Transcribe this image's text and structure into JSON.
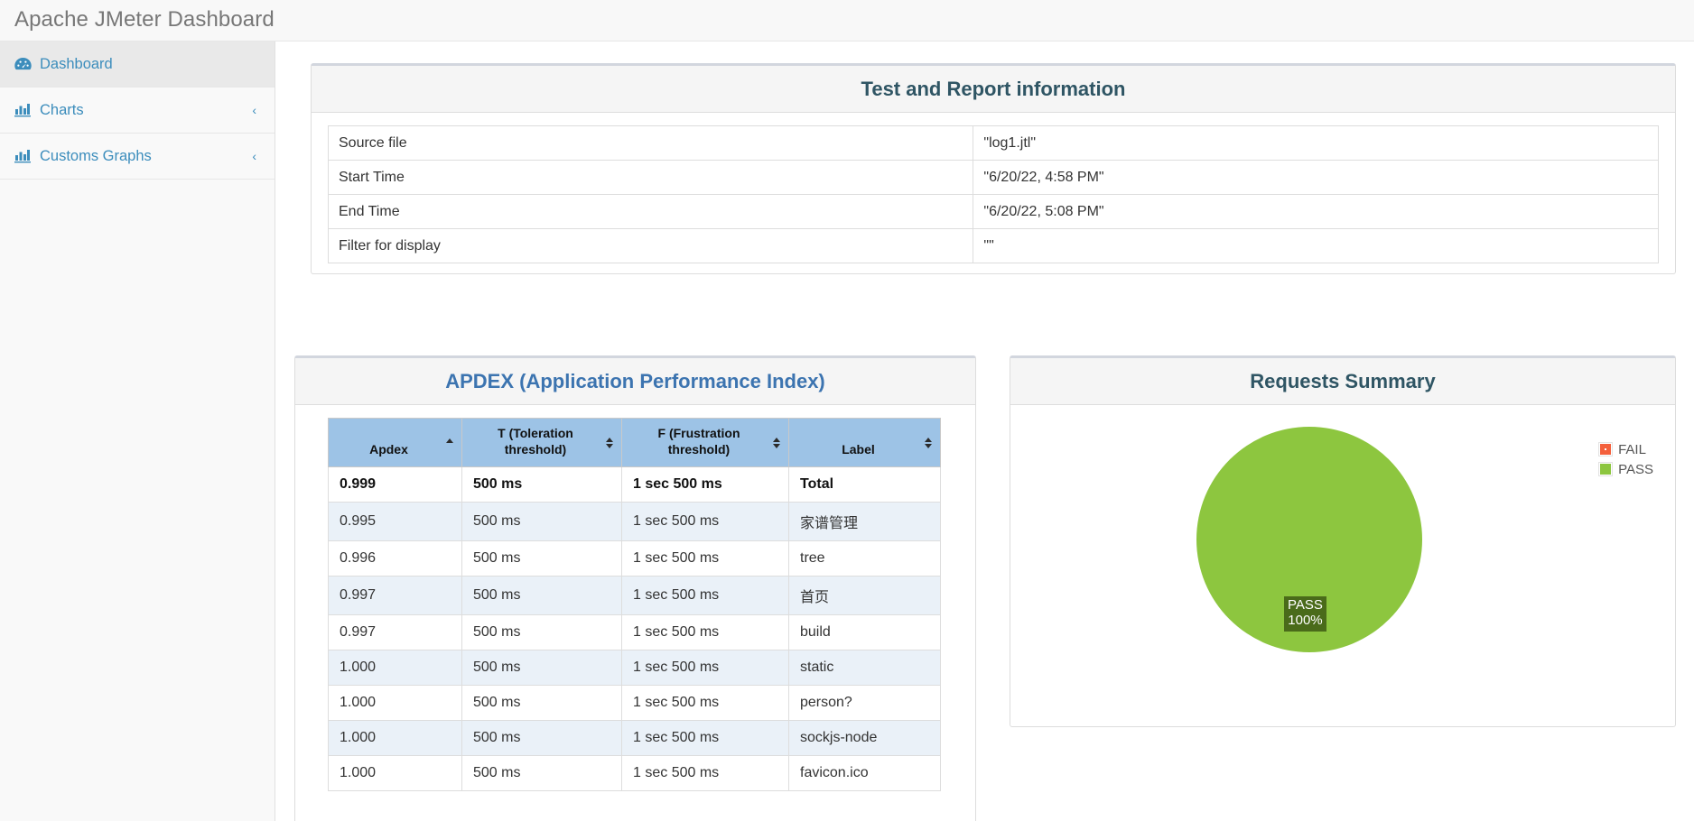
{
  "app": {
    "brand": "Apache JMeter Dashboard"
  },
  "sidebar": {
    "items": [
      {
        "label": "Dashboard",
        "icon": "dashboard-icon",
        "active": true,
        "chevron": ""
      },
      {
        "label": "Charts",
        "icon": "bar-chart-icon",
        "active": false,
        "chevron": "‹"
      },
      {
        "label": "Customs Graphs",
        "icon": "bar-chart-icon",
        "active": false,
        "chevron": "‹"
      }
    ]
  },
  "info_panel": {
    "title": "Test and Report information",
    "rows": [
      {
        "key": "Source file",
        "value": "\"log1.jtl\""
      },
      {
        "key": "Start Time",
        "value": "\"6/20/22, 4:58 PM\""
      },
      {
        "key": "End Time",
        "value": "\"6/20/22, 5:08 PM\""
      },
      {
        "key": "Filter for display",
        "value": "\"\""
      }
    ]
  },
  "apdex_panel": {
    "title": "APDEX (Application Performance Index)",
    "columns": [
      {
        "label": "Apdex",
        "sort": "asc"
      },
      {
        "label": "T (Toleration threshold)",
        "sort": "none"
      },
      {
        "label": "F (Frustration threshold)",
        "sort": "none"
      },
      {
        "label": "Label",
        "sort": "none"
      }
    ],
    "rows": [
      {
        "apdex": "0.999",
        "t": "500 ms",
        "f": "1 sec 500 ms",
        "label": "Total",
        "total": true
      },
      {
        "apdex": "0.995",
        "t": "500 ms",
        "f": "1 sec 500 ms",
        "label": "家谱管理",
        "total": false
      },
      {
        "apdex": "0.996",
        "t": "500 ms",
        "f": "1 sec 500 ms",
        "label": "tree",
        "total": false
      },
      {
        "apdex": "0.997",
        "t": "500 ms",
        "f": "1 sec 500 ms",
        "label": "首页",
        "total": false
      },
      {
        "apdex": "0.997",
        "t": "500 ms",
        "f": "1 sec 500 ms",
        "label": "build",
        "total": false
      },
      {
        "apdex": "1.000",
        "t": "500 ms",
        "f": "1 sec 500 ms",
        "label": "static",
        "total": false
      },
      {
        "apdex": "1.000",
        "t": "500 ms",
        "f": "1 sec 500 ms",
        "label": "person?",
        "total": false
      },
      {
        "apdex": "1.000",
        "t": "500 ms",
        "f": "1 sec 500 ms",
        "label": "sockjs-node",
        "total": false
      },
      {
        "apdex": "1.000",
        "t": "500 ms",
        "f": "1 sec 500 ms",
        "label": "favicon.ico",
        "total": false
      }
    ]
  },
  "requests_summary": {
    "title": "Requests Summary",
    "slice_label_name": "PASS",
    "slice_label_pct": "100%",
    "legend": [
      {
        "label": "FAIL",
        "color": "#f4603c"
      },
      {
        "label": "PASS",
        "color": "#8dc63f"
      }
    ]
  },
  "colors": {
    "pie_pass": "#8dc63f",
    "pie_fail": "#f4603c",
    "slice_label_bg": "#4a6b1a",
    "table_header": "#9dc3e6",
    "row_alt": "#eaf1f8",
    "link_blue": "#3c8dbc",
    "title_blue": "#3c74b0",
    "title_dark": "#2f5564"
  },
  "chart_data": {
    "type": "pie",
    "title": "Requests Summary",
    "categories": [
      "FAIL",
      "PASS"
    ],
    "values": [
      0,
      100
    ],
    "value_labels": [
      "",
      "PASS 100%"
    ],
    "colors": [
      "#f4603c",
      "#8dc63f"
    ],
    "legend_position": "right",
    "units": "percent"
  }
}
